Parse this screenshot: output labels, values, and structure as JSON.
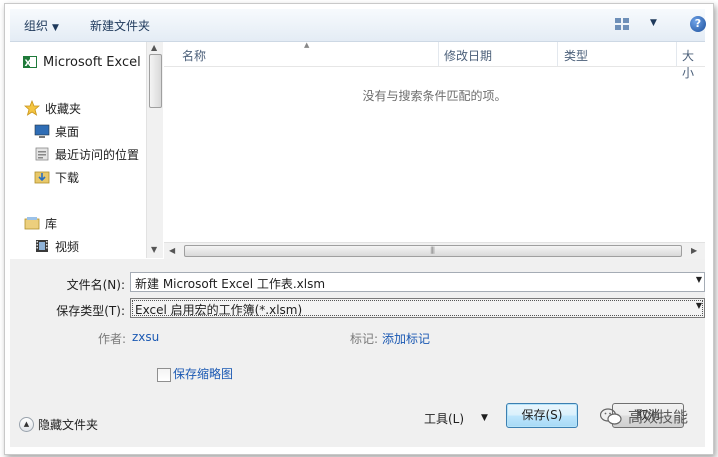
{
  "toolbar": {
    "organize": "组织",
    "new_folder": "新建文件夹",
    "help": "?"
  },
  "nav": {
    "items": [
      {
        "label": "Microsoft Excel",
        "icon": "excel-icon"
      },
      {
        "label": "收藏夹",
        "icon": "star-icon"
      },
      {
        "label": "桌面",
        "icon": "desktop-icon"
      },
      {
        "label": "最近访问的位置",
        "icon": "recent-places-icon"
      },
      {
        "label": "下载",
        "icon": "download-icon"
      },
      {
        "label": "库",
        "icon": "library-icon"
      },
      {
        "label": "视频",
        "icon": "video-icon"
      }
    ]
  },
  "list": {
    "columns": [
      "名称",
      "修改日期",
      "类型",
      "大小"
    ],
    "empty_message": "没有与搜索条件匹配的项。"
  },
  "form": {
    "filename_label": "文件名(N):",
    "filename_value": "新建 Microsoft Excel 工作表.xlsm",
    "filetype_label": "保存类型(T):",
    "filetype_value": "Excel 启用宏的工作簿(*.xlsm)",
    "author_label": "作者:",
    "author_value": "zxsu",
    "tags_label": "标记:",
    "tags_value": "添加标记",
    "thumbnail_label": "保存缩略图",
    "thumbnail_checked": false
  },
  "footer": {
    "hide_folders": "隐藏文件夹",
    "tools": "工具(L)",
    "save": "保存(S)",
    "cancel": "取消"
  },
  "watermark": {
    "text": "高效技能"
  }
}
